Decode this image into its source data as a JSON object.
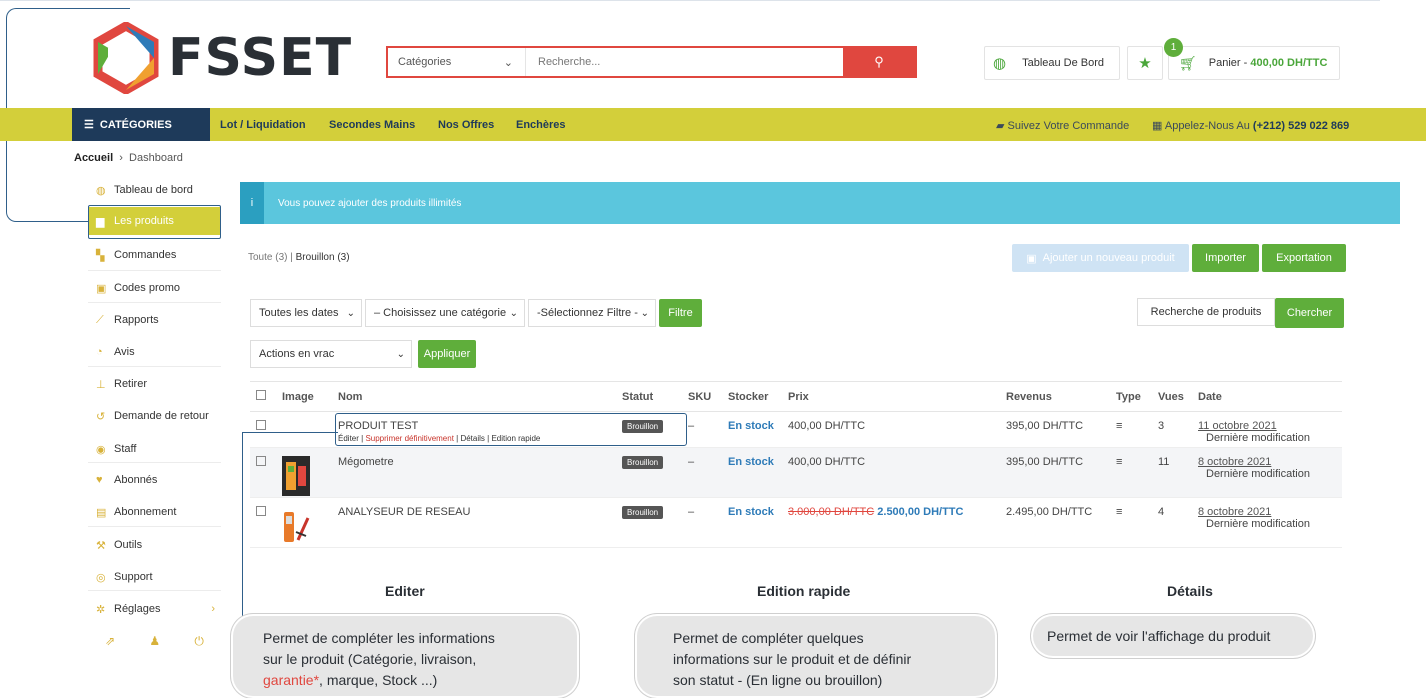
{
  "header": {
    "logo_text": "FSSET",
    "search_category": "Catégories",
    "search_placeholder": "Recherche...",
    "dashboard_label": "Tableau De Bord",
    "cart_count": "1",
    "cart_label": "Panier",
    "cart_total": "400,00 DH/TTC"
  },
  "nav": {
    "categories_label": "CATÉGORIES",
    "links": [
      "Lot / Liquidation",
      "Secondes Mains",
      "Nos Offres",
      "Enchères"
    ],
    "track_order": "Suivez Votre Commande",
    "call_label": "Appelez-Nous Au",
    "phone": "(+212) 529 022 869"
  },
  "breadcrumb": {
    "home": "Accueil",
    "current": "Dashboard"
  },
  "sidebar": {
    "items": [
      {
        "label": "Tableau de bord",
        "icon": "dashboard-icon"
      },
      {
        "label": "Les produits",
        "icon": "briefcase-icon",
        "active": true
      },
      {
        "label": "Commandes",
        "icon": "cart-icon"
      },
      {
        "label": "Codes promo",
        "icon": "gift-icon"
      },
      {
        "label": "Rapports",
        "icon": "chart-icon"
      },
      {
        "label": "Avis",
        "icon": "comment-icon"
      },
      {
        "label": "Retirer",
        "icon": "withdraw-icon"
      },
      {
        "label": "Demande de retour",
        "icon": "return-icon"
      },
      {
        "label": "Staff",
        "icon": "group-icon"
      },
      {
        "label": "Abonnés",
        "icon": "heart-icon"
      },
      {
        "label": "Abonnement",
        "icon": "book-icon"
      },
      {
        "label": "Outils",
        "icon": "wrench-icon"
      },
      {
        "label": "Support",
        "icon": "support-icon"
      },
      {
        "label": "Réglages",
        "icon": "cog-icon"
      }
    ]
  },
  "alert": {
    "text": "Vous pouvez ajouter des produits illimités"
  },
  "filters": {
    "all_tab": "Toute (3)",
    "draft_tab": "Brouillon (3)",
    "add_product": "Ajouter un nouveau produit",
    "import": "Importer",
    "export": "Exportation",
    "dates": "Toutes les dates",
    "category": "– Choisissez une catégorie",
    "filter_select": "-Sélectionnez Filtre -",
    "filter_btn": "Filtre",
    "search_products": "Recherche de produits",
    "search_btn": "Chercher",
    "bulk_actions": "Actions en vrac",
    "apply": "Appliquer"
  },
  "table": {
    "headers": [
      "Image",
      "Nom",
      "Statut",
      "SKU",
      "Stocker",
      "Prix",
      "Revenus",
      "Type",
      "Vues",
      "Date"
    ],
    "rows": [
      {
        "name": "PRODUIT TEST",
        "status": "Brouillon",
        "sku": "–",
        "stock": "En stock",
        "price": "400,00 DH/TTC",
        "old_price": "",
        "revenue": "395,00 DH/TTC",
        "views": "3",
        "date": "11 octobre 2021",
        "modified": "Dernière modification"
      },
      {
        "name": "Mégometre",
        "status": "Brouillon",
        "sku": "–",
        "stock": "En stock",
        "price": "400,00 DH/TTC",
        "old_price": "",
        "revenue": "395,00 DH/TTC",
        "views": "11",
        "date": "8 octobre 2021",
        "modified": "Dernière modification"
      },
      {
        "name": "ANALYSEUR DE RESEAU",
        "status": "Brouillon",
        "sku": "–",
        "stock": "En stock",
        "price": "2.500,00 DH/TTC",
        "old_price": "3.000,00 DH/TTC",
        "revenue": "2.495,00 DH/TTC",
        "views": "4",
        "date": "8 octobre 2021",
        "modified": "Dernière modification"
      }
    ],
    "row_actions": {
      "edit": "Éditer",
      "delete": "Supprimer définitivement",
      "details": "Détails",
      "quick_edit": "Edition rapide"
    }
  },
  "captions": {
    "edit_title": "Editer",
    "edit_text_1": "Permet de compléter les informations",
    "edit_text_2": "sur le produit (Catégorie, livraison,",
    "edit_text_3a": "garantie*",
    "edit_text_3b": ", marque, Stock ...)",
    "quick_title": "Edition rapide",
    "quick_text_1": "Permet de compléter quelques",
    "quick_text_2": "informations sur le produit et de définir",
    "quick_text_3": "son statut - (En ligne ou brouillon)",
    "details_title": "Détails",
    "details_text": "Permet de voir l'affichage du produit"
  },
  "colors": {
    "accent": "#d3cf3a",
    "navy": "#1e3a5a",
    "green": "#5fae3b",
    "red": "#e0473f",
    "info": "#5bc6dd"
  }
}
